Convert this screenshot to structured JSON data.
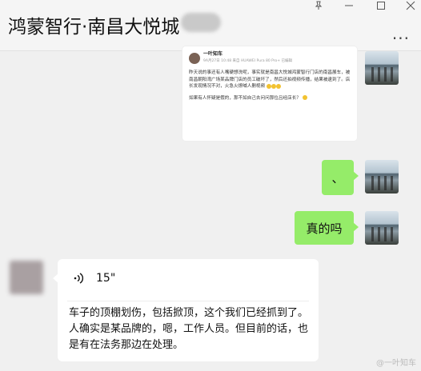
{
  "window": {
    "title": "鸿蒙智行·南昌大悦城",
    "more_glyph": "···"
  },
  "card": {
    "author": "一叶知车",
    "meta": "9A月27日 10:48 来自 HUAWEI Pura 80 Pro+ 已编辑",
    "body": "昨天说的事还有人嘴硬想洗呢，事实就是南昌大悦城鸿蒙智行门店的南昌展车，被南昌朝阳湾广场某品牌门店的员工破坏了，然后还拍视频传播，结果被逮到了。店长发现情况不对，火急火燎喊人删视频",
    "question": "如果有人怀疑是假的，那不如自己去问问那位吕经店长？"
  },
  "messages": {
    "sent1": "、",
    "sent2": "真的吗"
  },
  "voice": {
    "duration": "15\"",
    "transcript": "车子的顶棚划伤，包括掀顶，这个我们已经抓到了。人确实是某品牌的，嗯，工作人员。但目前的话，也是有在法务那边在处理。"
  },
  "watermark": "@一叶知车"
}
